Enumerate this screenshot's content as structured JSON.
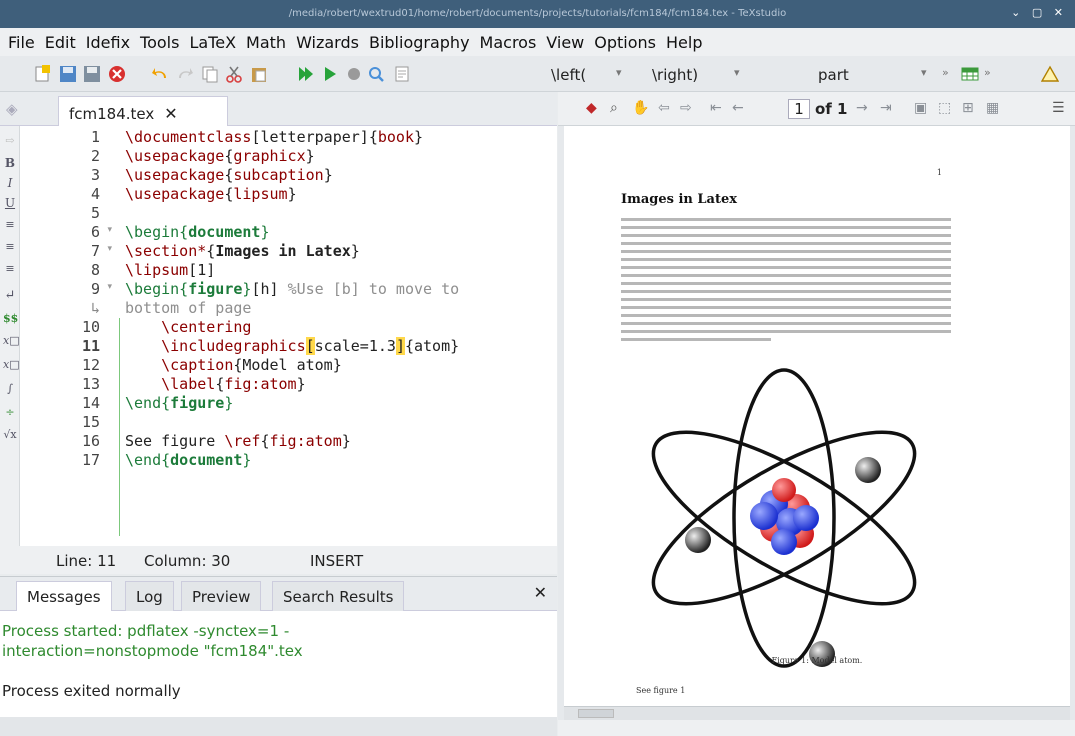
{
  "window": {
    "title": "/media/robert/wextrud01/home/robert/documents/projects/tutorials/fcm184/fcm184.tex - TeXstudio"
  },
  "menu": [
    "File",
    "Edit",
    "Idefix",
    "Tools",
    "LaTeX",
    "Math",
    "Wizards",
    "Bibliography",
    "Macros",
    "View",
    "Options",
    "Help"
  ],
  "toolbar": {
    "left_delim": "\\left(",
    "right_delim": "\\right)",
    "structure": "part",
    "more": "»"
  },
  "editor": {
    "tab": "fcm184.tex",
    "line_numbers": [
      "1",
      "2",
      "3",
      "4",
      "5",
      "6",
      "7",
      "8",
      "9",
      "",
      "10",
      "11",
      "12",
      "13",
      "14",
      "15",
      "16",
      "17"
    ],
    "status": {
      "line": "Line: 11",
      "column": "Column: 30",
      "mode": "INSERT"
    }
  },
  "messages": {
    "tabs": [
      "Messages",
      "Log",
      "Preview",
      "Search Results"
    ],
    "line1": "Process started: pdflatex -synctex=1 -",
    "line2": "interaction=nonstopmode \"fcm184\".tex",
    "line3": "Process exited normally"
  },
  "pdf": {
    "page_current": "1",
    "page_of": "of 1",
    "page_number": "1",
    "section_title": "Images in Latex",
    "caption": "Figure 1: Model atom.",
    "see_text": "See figure 1"
  }
}
